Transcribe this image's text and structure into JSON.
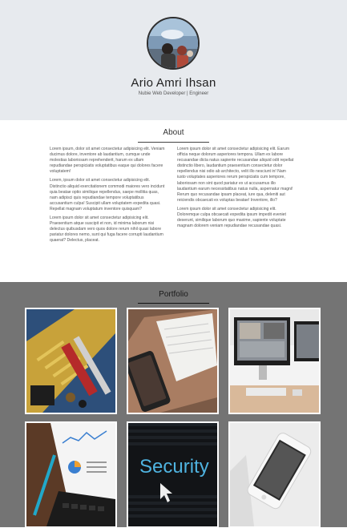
{
  "profile": {
    "name": "Ario Amri Ihsan",
    "subtitle": "Nubie Web Developer | Engineer"
  },
  "about": {
    "title": "About",
    "left_paragraphs": [
      "Lorem ipsum, dolor sit amet consectetur adipisicing elit. Veniam ducimus dolore, inventore ab laudantium, cumque unde molestias laboriosam reprehenderit, harum ex ullam repudiandae perspiciatis voluptatibus eaque qui dolores facere voluptatem!",
      "Lorem, ipsum dolor sit amet consectetur adipisicing elit. Distinctio aliquid exercitationem commodi maiores vero incidunt quia beatae optio similique repellendus, saepe mollitia quas, nam adipisci quis repudiandae tempore voluptatibus accusantium culpa! Suscipit ullam voluptatem expedita quasi. Repellat magnam voluptatum inventore quisquam?",
      "Lorem ipsum dolor sit amet consectetur adipisicing elit. Praesentium atque suscipit et non, id minima laborum nisi delectus quibusdam vero quos dolore rerum nihil quasi labore pariatur dolores nemo, sunt qui fuga facere corrupti laudantium quaerat? Delectus, placeat."
    ],
    "right_paragraphs": [
      "Lorem ipsum dolor sit amet consectetur adipisicing elit. Earum officia neque dolorum asperiores tempora. Ullam ex labore recusandae dicta natus sapiente recusandae aliquid odit repellat distinctio libero, laudantium praesentium consectetur dolor repellendus nisi odio ab architecto, velit illo nesciunt in! Nam iusto voluptates asperiores rerum perspiciatis cum tempore, laboriosam non sint quod pariatur ex ut accusamus illo laudantium earum necessitatibus natus nulla, aspernatur magni! Rerum quo recusandae ipsam placeat, iure qua, deleniti aut reiciendis obcaecati ex voluptas beatae! Inventore, illo?",
      "Lorem ipsum dolor sit amet consectetur adipisicing elit. Doloremque culpa obcaecati expedita ipsum impedit eveniet deserunt, similique laborum quo maxime, sapiente voluptate magnam dolorem veniam repudiandae recusandae quasi."
    ]
  },
  "portfolio": {
    "title": "Portfolio",
    "items": [
      {
        "name": "circuit-board"
      },
      {
        "name": "notebook-phone"
      },
      {
        "name": "desktop-workspace"
      },
      {
        "name": "analytics-report"
      },
      {
        "name": "security-screen",
        "screen_text": "Security"
      },
      {
        "name": "white-phone"
      }
    ]
  },
  "colors": {
    "header_bg": "#e7eaee",
    "portfolio_bg": "#747474"
  }
}
